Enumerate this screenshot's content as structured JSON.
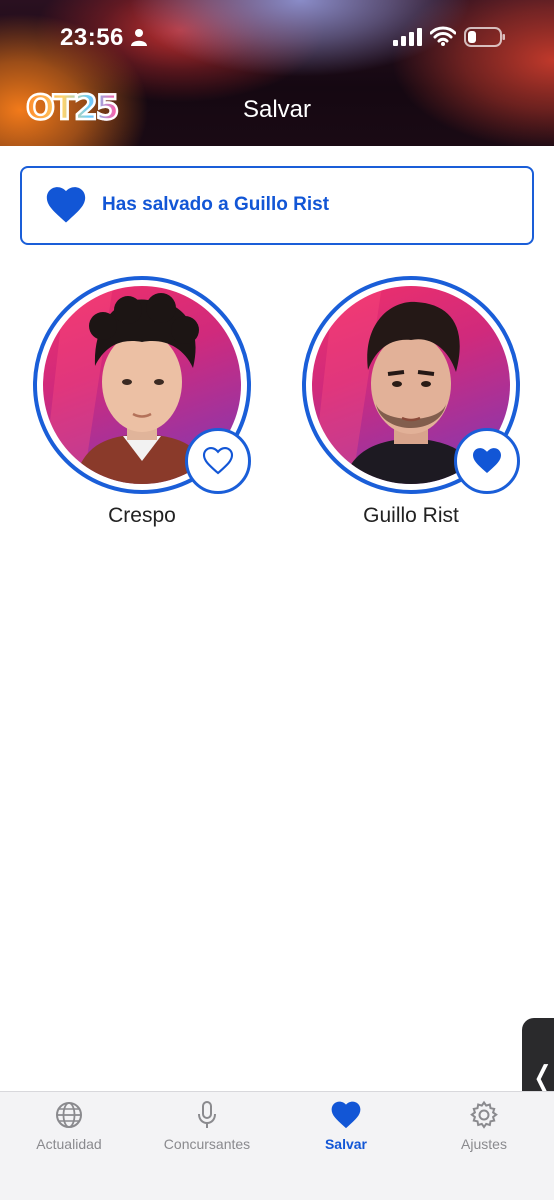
{
  "status_bar": {
    "time": "23:56",
    "icons": [
      "person-icon",
      "signal-icon",
      "wifi-icon",
      "battery-icon"
    ]
  },
  "header": {
    "logo": "OT25",
    "title": "Salvar"
  },
  "banner": {
    "icon": "heart-filled-icon",
    "text": "Has salvado a Guillo Rist"
  },
  "contestants": [
    {
      "name": "Crespo",
      "saved": false,
      "icon": "heart-outline-icon"
    },
    {
      "name": "Guillo Rist",
      "saved": true,
      "icon": "heart-filled-icon"
    }
  ],
  "tabbar": {
    "items": [
      {
        "label": "Actualidad",
        "icon": "globe-icon",
        "active": false
      },
      {
        "label": "Concursantes",
        "icon": "microphone-icon",
        "active": false
      },
      {
        "label": "Salvar",
        "icon": "heart-icon",
        "active": true
      },
      {
        "label": "Ajustes",
        "icon": "gear-icon",
        "active": false
      }
    ]
  },
  "colors": {
    "accent": "#1256d6",
    "ring": "#1a5ed8",
    "tab_inactive": "#8a8a8e",
    "tabbar_bg": "#f3f3f5"
  }
}
